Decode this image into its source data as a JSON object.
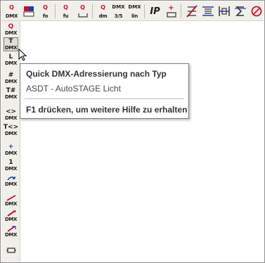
{
  "toolbar": {
    "buttons": [
      {
        "top": "Q",
        "label": "DMX"
      },
      {
        "top": "",
        "label": ""
      },
      {
        "top": "Q",
        "label": "fo"
      },
      {
        "top": "Q",
        "label": "fu"
      },
      {
        "top": "Q",
        "label": ""
      },
      {
        "top": "Q",
        "label": "dm"
      },
      {
        "top": "DMX",
        "label": "3/5"
      },
      {
        "top": "DMX",
        "label": "lin"
      },
      {
        "top": "IP",
        "label": ""
      },
      {
        "top": "+",
        "label": ""
      },
      {
        "top": "",
        "label": ""
      },
      {
        "top": "",
        "label": ""
      },
      {
        "top": "",
        "label": ""
      },
      {
        "top": "",
        "label": ""
      },
      {
        "top": "",
        "label": ""
      }
    ]
  },
  "sidebar": {
    "buttons": [
      {
        "g1": "Q",
        "g2": "DMX"
      },
      {
        "g1": "T",
        "g2": "DMX"
      },
      {
        "g1": "L",
        "g2": "DMX"
      },
      {
        "g1": "#",
        "g2": "DMX"
      },
      {
        "g1": "T#",
        "g2": "DMX"
      },
      {
        "g1": "<>",
        "g2": "DMX"
      },
      {
        "g1": "T<>",
        "g2": "DMX"
      },
      {
        "g1": "+",
        "g2": "DMX"
      },
      {
        "g1": "1",
        "g2": "DMX"
      },
      {
        "g1": "",
        "g2": "DMX"
      },
      {
        "g1": "",
        "g2": "DMX"
      },
      {
        "g1": "",
        "g2": "DMX"
      },
      {
        "g1": "",
        "g2": "DMX"
      },
      {
        "g1": "",
        "g2": ""
      }
    ]
  },
  "tooltip": {
    "title": "Quick DMX-Adressierung nach Typ",
    "subtitle": "ASDT - AutoSTAGE Licht",
    "help": "F1 drücken, um weitere Hilfe zu erhalten"
  }
}
